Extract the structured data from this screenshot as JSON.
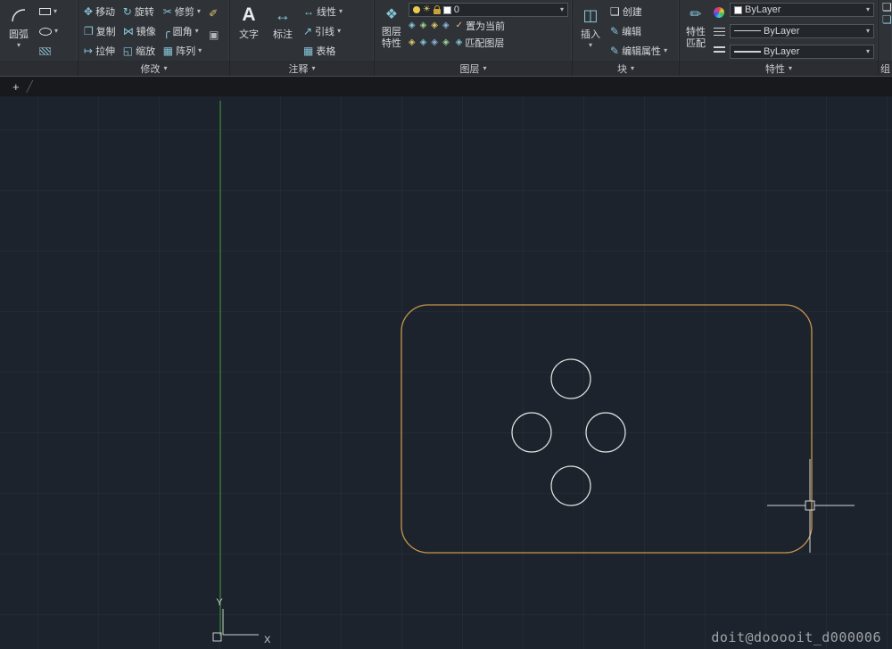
{
  "icons": {
    "caret_down": "▾",
    "move": "✥",
    "rotate": "↻",
    "trim": "✂",
    "copy": "❐",
    "mirror": "⋈",
    "fillet": "╭",
    "stretch": "↦",
    "scale": "◱",
    "array": "▦",
    "erase": "✐",
    "explode": "▣",
    "text": "A",
    "dimension": "↔",
    "linear": "↔",
    "leader": "↗",
    "table": "▦",
    "layers": "❖",
    "sun": "☀",
    "layer_tool": "◈",
    "set_current_check": "✓",
    "insert": "◫",
    "create": "❑",
    "edit": "✎",
    "match_properties": "✏",
    "group": "❏",
    "plus": "+",
    "slash": "╱"
  },
  "ribbon": {
    "draw": {
      "arc_label": "圆弧"
    },
    "modify": {
      "label": "修改",
      "move": "移动",
      "rotate": "旋转",
      "trim": "修剪",
      "copy": "复制",
      "mirror": "镜像",
      "fillet": "圆角",
      "stretch": "拉伸",
      "scale": "缩放",
      "array": "阵列"
    },
    "annotate": {
      "label": "注释",
      "text": "文字",
      "dimension": "标注",
      "linear": "线性",
      "leader": "引线",
      "table": "表格"
    },
    "layers": {
      "label": "图层",
      "layer_properties": "图层特性",
      "current_layer": "0",
      "set_current": "置为当前",
      "match_layer": "匹配图层"
    },
    "block": {
      "label": "块",
      "insert": "插入",
      "create": "创建",
      "edit": "编辑",
      "edit_attributes": "编辑属性"
    },
    "properties": {
      "label": "特性",
      "match_properties": "特性匹配",
      "color": "ByLayer",
      "linetype": "ByLayer",
      "lineweight": "ByLayer"
    },
    "group": {
      "label": "组"
    }
  },
  "canvas": {
    "ucs": {
      "x": "X",
      "y": "Y"
    },
    "watermark": "doit@dooooit_d000006"
  }
}
